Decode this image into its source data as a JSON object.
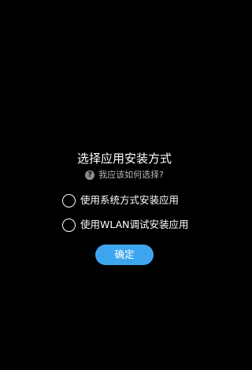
{
  "dialog": {
    "title": "选择应用安装方式",
    "help_icon": "question-circle-icon",
    "help_text": "我应该如何选择?",
    "options": [
      {
        "label": "使用系统方式安装应用",
        "selected": false
      },
      {
        "label": "使用WLAN调试安装应用",
        "selected": false
      }
    ],
    "confirm_label": "确定",
    "colors": {
      "background": "#000000",
      "text": "#ffffff",
      "help_text": "#b8b8b8",
      "accent": "#3ea6ee"
    }
  }
}
